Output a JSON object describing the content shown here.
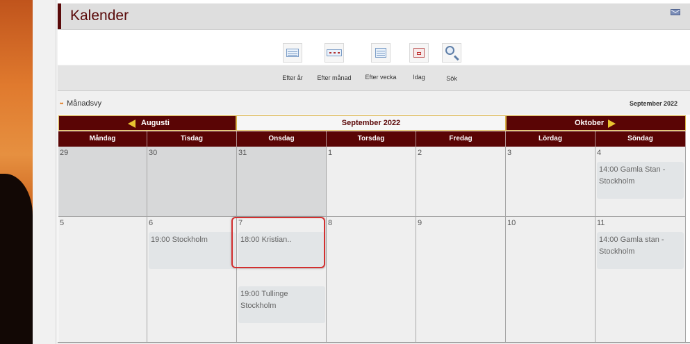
{
  "page_title": "Kalender",
  "toolbar": {
    "items": [
      {
        "label": "Efter år",
        "icon": "calendar-year-icon"
      },
      {
        "label": "Efter månad",
        "icon": "calendar-month-icon"
      },
      {
        "label": "Efter vecka",
        "icon": "calendar-week-icon"
      },
      {
        "label": "Idag",
        "icon": "calendar-today-icon"
      },
      {
        "label": "Sök",
        "icon": "search-icon"
      }
    ]
  },
  "view": {
    "label": "Månadsvy",
    "current": "September 2022"
  },
  "nav": {
    "prev": "Augusti",
    "current": "September 2022",
    "next": "Oktober"
  },
  "weekdays": [
    "Måndag",
    "Tisdag",
    "Onsdag",
    "Torsdag",
    "Fredag",
    "Lördag",
    "Söndag"
  ],
  "weeks": [
    [
      {
        "day": "29",
        "other": true,
        "events": []
      },
      {
        "day": "30",
        "other": true,
        "events": []
      },
      {
        "day": "31",
        "other": true,
        "events": []
      },
      {
        "day": "1",
        "other": false,
        "events": []
      },
      {
        "day": "2",
        "other": false,
        "events": []
      },
      {
        "day": "3",
        "other": false,
        "events": []
      },
      {
        "day": "4",
        "other": false,
        "events": [
          "14:00 Gamla Stan - Stockholm"
        ]
      }
    ],
    [
      {
        "day": "5",
        "other": false,
        "events": []
      },
      {
        "day": "6",
        "other": false,
        "events": [
          "19:00 Stockholm"
        ]
      },
      {
        "day": "7",
        "other": false,
        "events": [
          "18:00 Kristian..",
          "19:00 Tullinge Stockholm"
        ]
      },
      {
        "day": "8",
        "other": false,
        "events": []
      },
      {
        "day": "9",
        "other": false,
        "events": []
      },
      {
        "day": "10",
        "other": false,
        "events": []
      },
      {
        "day": "11",
        "other": false,
        "events": [
          "14:00 Gamla stan - Stockholm"
        ]
      }
    ]
  ],
  "colors": {
    "accent": "#5a0505",
    "nav_border": "#d8b24a",
    "highlight": "#d32f2f"
  }
}
